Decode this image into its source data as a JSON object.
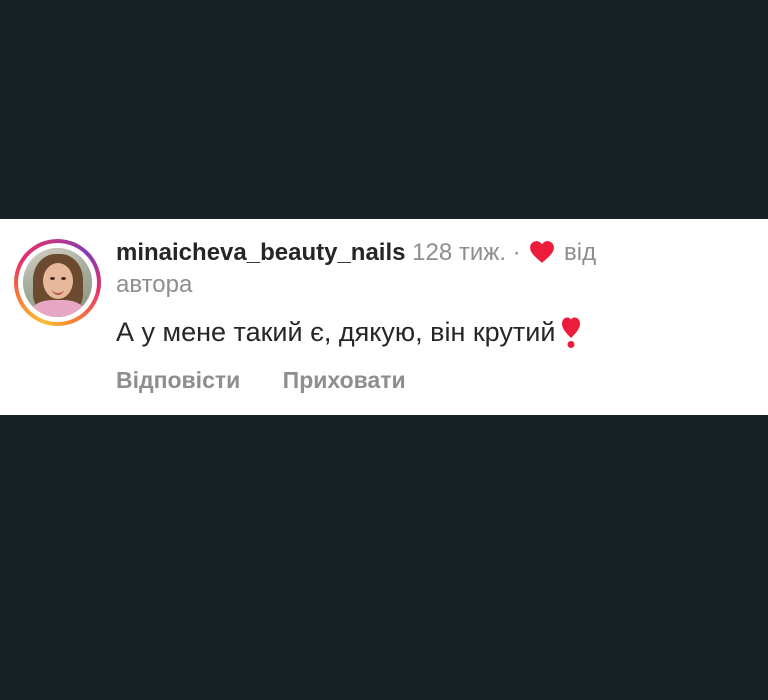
{
  "comment": {
    "username": "minaicheva_beauty_nails",
    "time": "128 тиж.",
    "separator": "·",
    "liked_by_author": "від автора",
    "text": "А у мене такий є, дякую, він крутий",
    "emoji": "heavy-heart-exclamation-icon"
  },
  "actions": {
    "reply_label": "Відповісти",
    "hide_label": "Приховати"
  },
  "colors": {
    "background": "#162223",
    "card": "#ffffff",
    "username": "#262626",
    "secondary_text": "#8e8e8e",
    "heart": "#ed1c3b"
  }
}
